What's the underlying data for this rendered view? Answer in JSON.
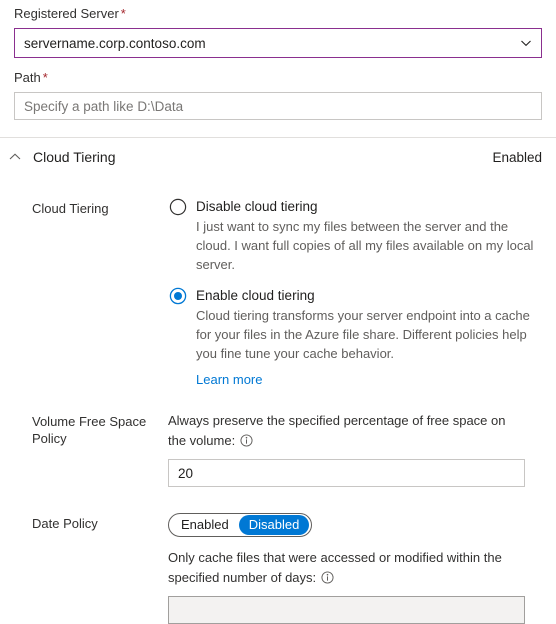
{
  "form": {
    "registered_server": {
      "label": "Registered Server",
      "required_marker": "*",
      "value": "servername.corp.contoso.com",
      "chevron_icon": "chevron-down-icon"
    },
    "path": {
      "label": "Path",
      "required_marker": "*",
      "placeholder": "Specify a path like D:\\Data",
      "value": ""
    }
  },
  "section": {
    "title": "Cloud Tiering",
    "status": "Enabled",
    "chevron_icon": "chevron-up-icon"
  },
  "cloud_tiering": {
    "row_label": "Cloud Tiering",
    "options": [
      {
        "title": "Disable cloud tiering",
        "description": "I just want to sync my files between the server and the cloud. I want full copies of all my files available on my local server.",
        "selected": false
      },
      {
        "title": "Enable cloud tiering",
        "description": "Cloud tiering transforms your server endpoint into a cache for your files in the Azure file share. Different policies help you fine tune your cache behavior.",
        "selected": true
      }
    ],
    "learn_more": "Learn more"
  },
  "volume_free_space": {
    "row_label": "Volume Free Space Policy",
    "description": "Always preserve the specified percentage of free space on the volume:",
    "info_icon": "info-icon",
    "value": "20"
  },
  "date_policy": {
    "row_label": "Date Policy",
    "toggle": {
      "options": [
        "Enabled",
        "Disabled"
      ],
      "selected": "Disabled"
    },
    "description": "Only cache files that were accessed or modified within the specified number of days:",
    "info_icon": "info-icon",
    "value": ""
  },
  "colors": {
    "accent_blue": "#0078d4",
    "dropdown_border_purple": "#8a2f8f",
    "required_red": "#a4262c",
    "link_blue": "#0078d4",
    "disabled_fill": "#f3f2f1"
  }
}
